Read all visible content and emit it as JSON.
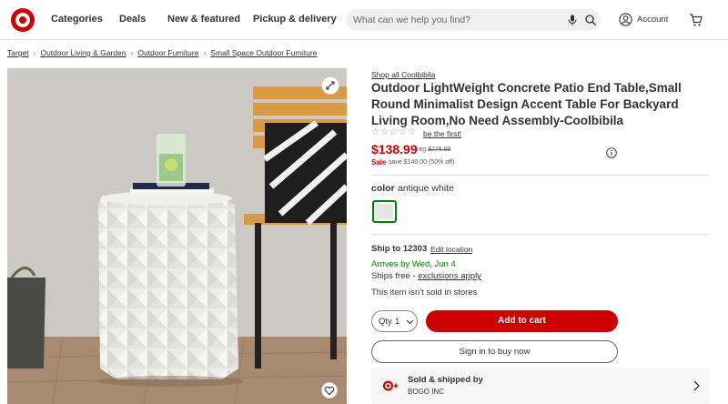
{
  "header": {
    "nav": [
      "Categories",
      "Deals",
      "New & featured",
      "Pickup & delivery"
    ],
    "search_placeholder": "What can we help you find?",
    "account_label": "Account"
  },
  "breadcrumb": [
    "Target",
    "Outdoor Living & Garden",
    "Outdoor Furniture",
    "Small Space Outdoor Furniture"
  ],
  "product": {
    "shop_all": "Shop all Coolbibila",
    "title": "Outdoor LightWeight Concrete Patio End Table,Small Round Minimalist Design Accent Table For Backyard Living Room,No Need Assembly-Coolbibila",
    "stars": "☆☆☆☆☆",
    "first_review_link": "be the first!",
    "price": "$138.99",
    "reg_label": "reg",
    "reg_price": "$278.99",
    "sale_label": "Sale",
    "save_text": "save $140.00 (50% off)",
    "color_label": "color",
    "color_value": "antique white"
  },
  "fulfillment": {
    "ship_to_label": "Ship to 12303",
    "edit_location": "Edit location",
    "arrives": "Arrives by Wed, Jun 4",
    "ships_free": "Ships free - ",
    "exclusions": "exclusions apply",
    "not_sold": "This item isn't sold in stores"
  },
  "purchase": {
    "qty_label": "Qty",
    "qty_value": "1",
    "add_to_cart": "Add to cart",
    "sign_in_buy": "Sign in to buy now"
  },
  "seller": {
    "title": "Sold & shipped by",
    "name": "BOGO INC"
  },
  "colors": {
    "brand_red": "#cc0000",
    "green": "#008300"
  }
}
